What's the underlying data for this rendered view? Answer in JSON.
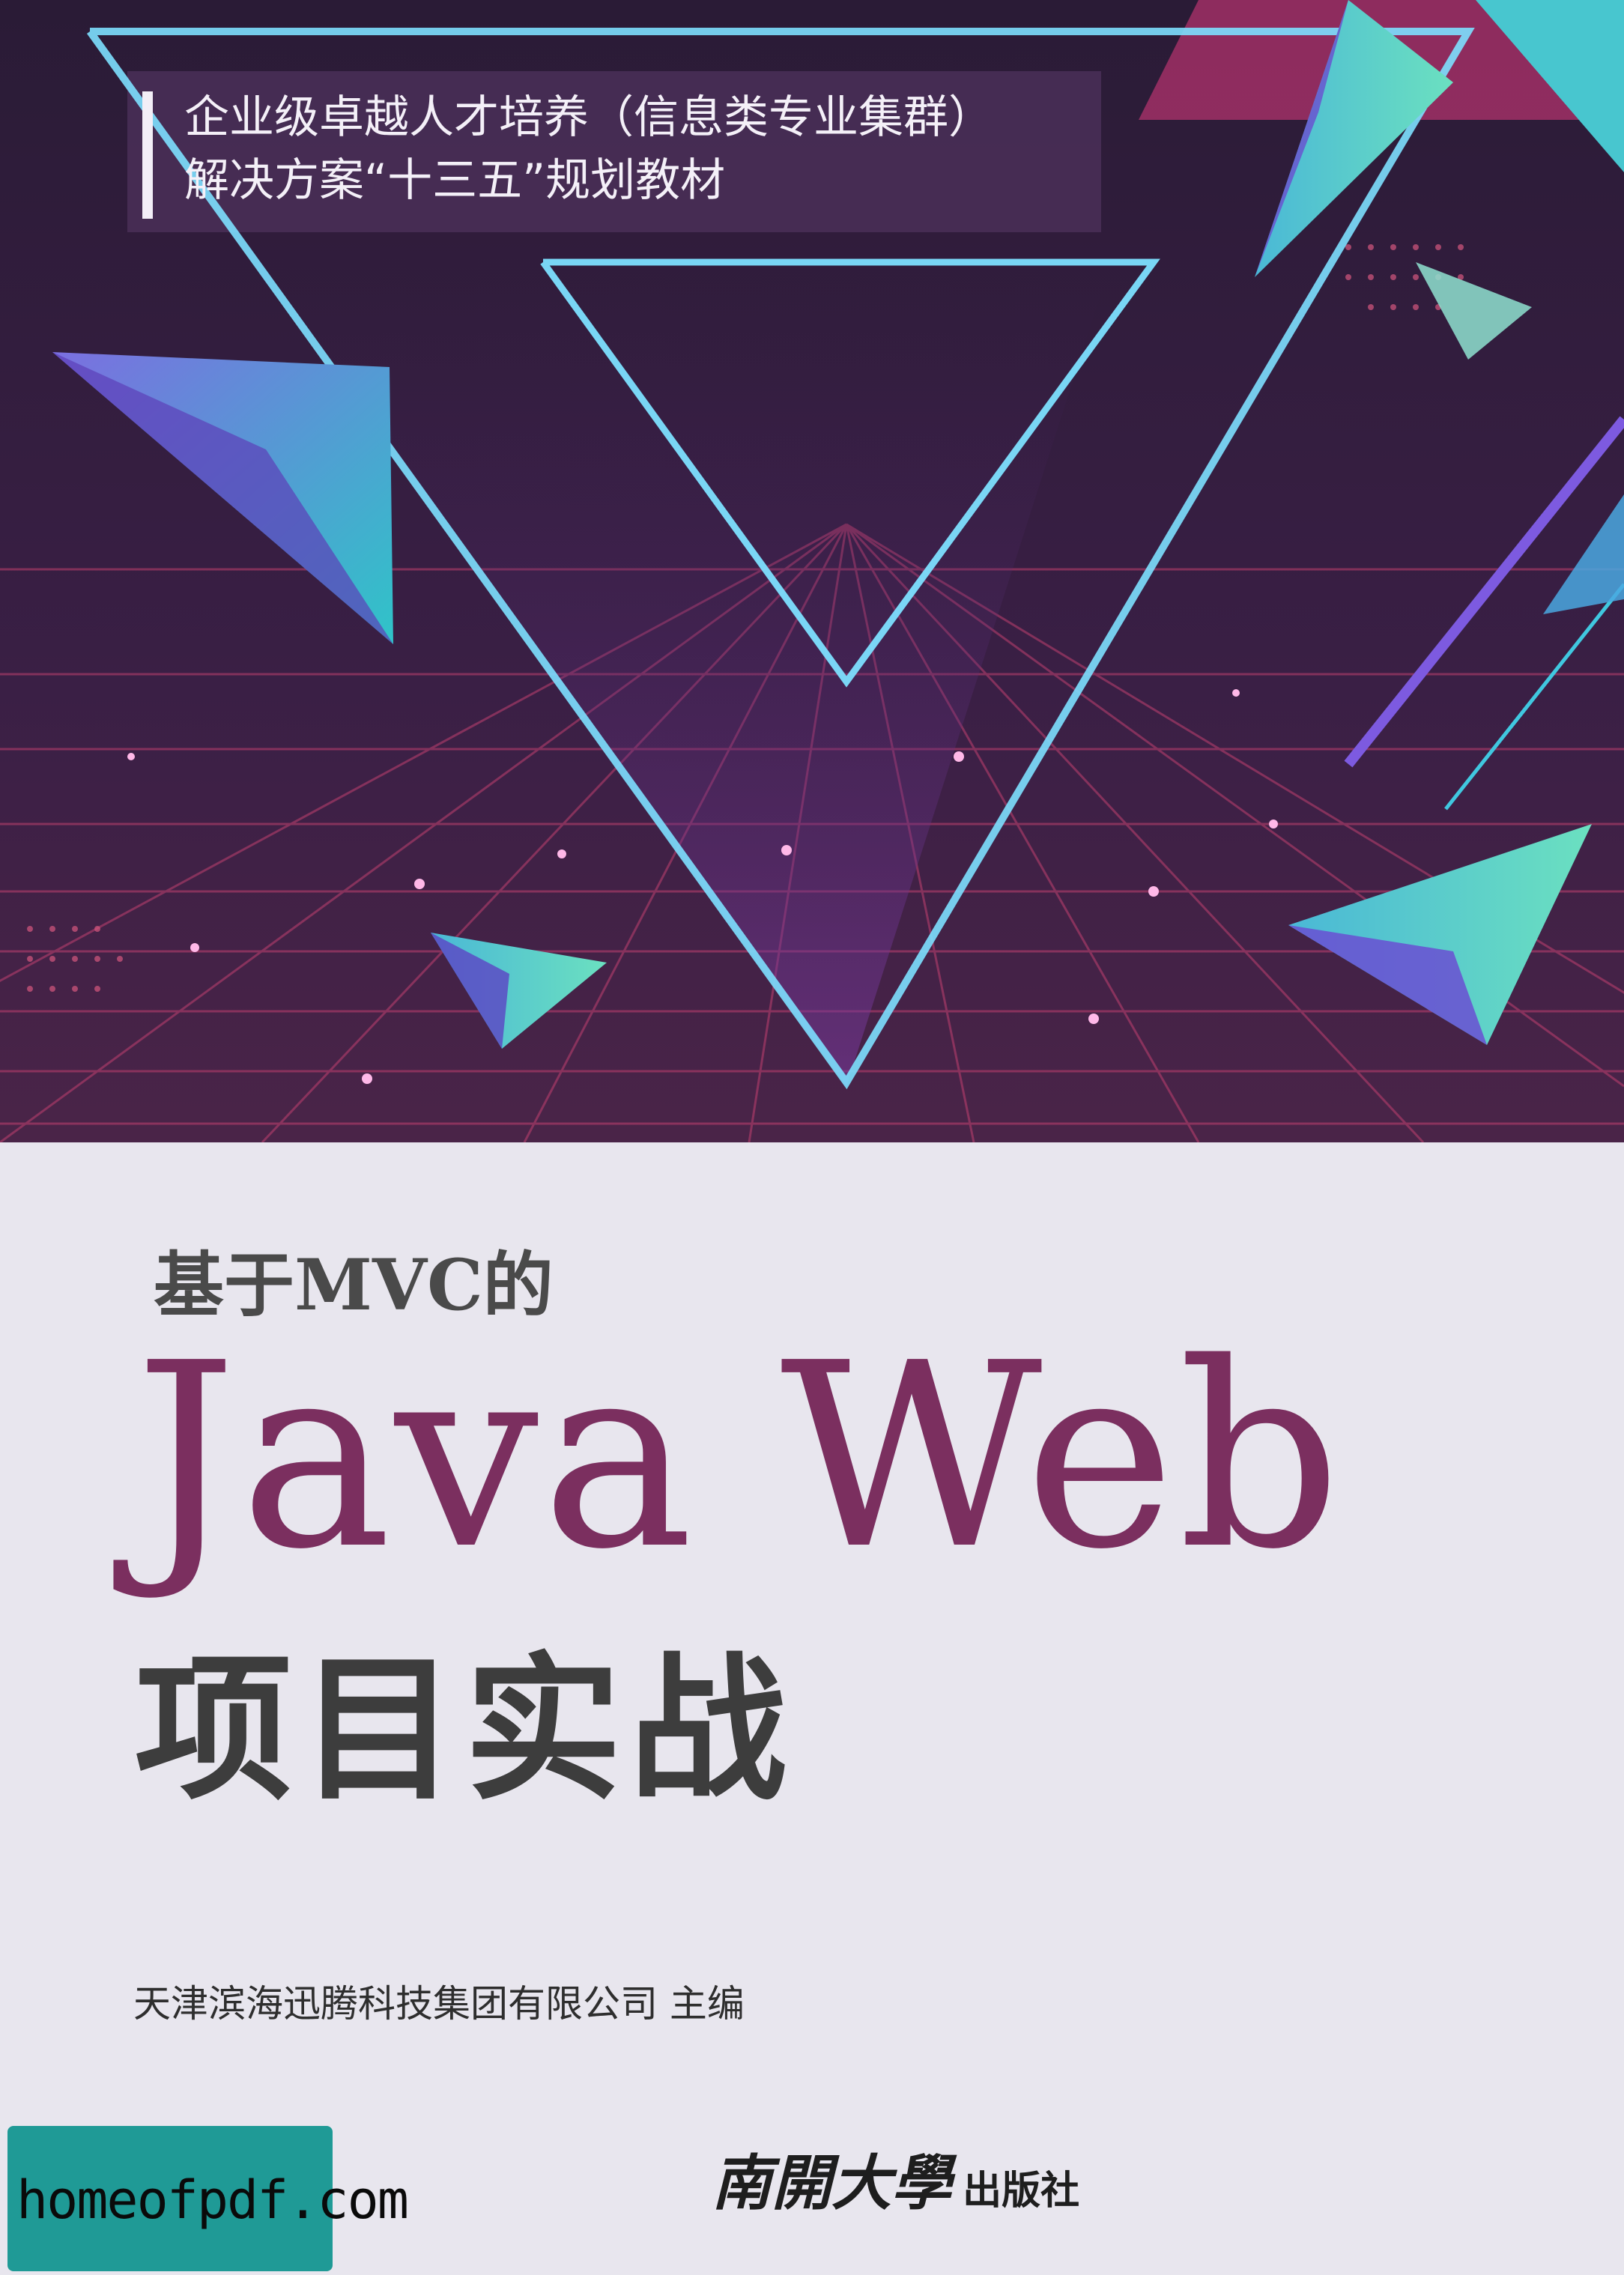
{
  "series": {
    "line1": "企业级卓越人才培养（信息类专业集群）",
    "line2": "解决方案“十三五”规划教材"
  },
  "title": {
    "pre": "基于MVC的",
    "main": "Java Web",
    "sub": "项目实战"
  },
  "editor": "天津滨海迅腾科技集团有限公司 主编",
  "publisher": {
    "logo": "南開大學",
    "press": "出版社"
  },
  "watermark": "homeofpdf.com",
  "colors": {
    "background_top": "#2e1a3a",
    "neon_line": "#6ed8f5",
    "grid": "#c0406f",
    "title_accent": "#7b2f5f",
    "watermark_bg": "#1f9a96"
  }
}
